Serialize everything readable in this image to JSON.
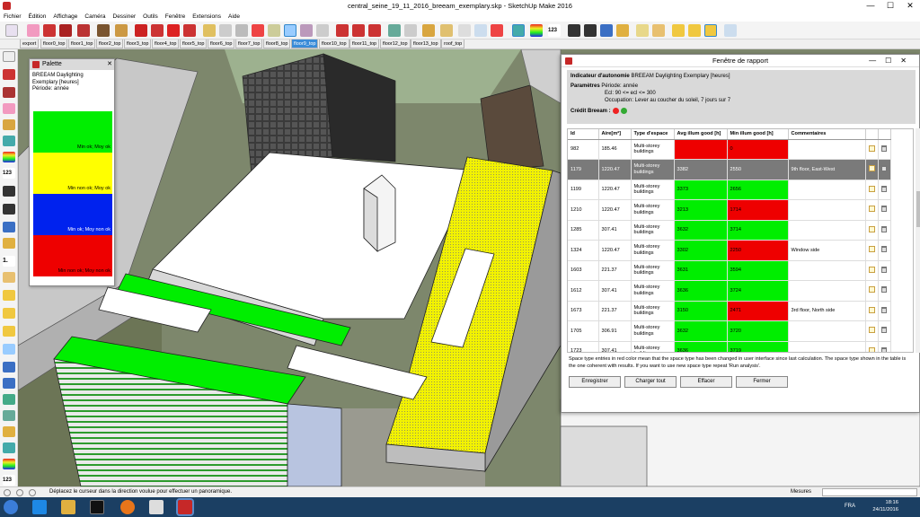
{
  "window": {
    "title": "central_seine_19_11_2016_breeam_exemplary.skp - SketchUp Make 2016",
    "minimize": "—",
    "maximize": "☐",
    "close": "✕"
  },
  "menu": [
    "Fichier",
    "Édition",
    "Affichage",
    "Caméra",
    "Dessiner",
    "Outils",
    "Fenêtre",
    "Extensions",
    "Aide"
  ],
  "scene_tabs": [
    "export",
    "floor0_top",
    "floor1_top",
    "floor2_top",
    "floor3_top",
    "floor4_top",
    "floor5_top",
    "floor6_top",
    "floor7_top",
    "floor8_top",
    "floor9_top",
    "floor10_top",
    "floor11_top",
    "floor12_top",
    "floor13_top",
    "roof_top"
  ],
  "active_scene": "floor9_top",
  "palette": {
    "title": "Palette",
    "close": "✕",
    "line1": "BREEAM Daylighting",
    "line2": "Exemplary [heures]",
    "line3": "Période: année",
    "swatches": [
      {
        "label": "Min ok; Moy ok",
        "color": "#00ee00"
      },
      {
        "label": "Min non ok; Moy ok",
        "color": "#ffff00"
      },
      {
        "label": "Min ok; Moy non ok",
        "color": "#0022ee"
      },
      {
        "label": "Min non ok; Moy non ok",
        "color": "#ee0000"
      }
    ]
  },
  "report": {
    "title": "Fenêtre de rapport",
    "indicator_label": "Indicateur d'autonomie",
    "indicator_value": "BREEAM Daylighting Exemplary [heures]",
    "params_label": "Paramètres",
    "param1": "Période: année",
    "param2": "Ecl: 90 <= ecl <= 300",
    "param3": "Occupation: Lever au coucher du soleil, 7 jours sur 7",
    "credit_label": "Crédit Breeam :",
    "headers": [
      "Id",
      "Aire[m²]",
      "Type d'espace",
      "Avg illum good [h]",
      "Min illum good [h]",
      "Commentaires"
    ],
    "rows": [
      {
        "id": "982",
        "area": "185.46",
        "type": "Multi-storey buildings",
        "avg": "",
        "min": "0",
        "comment": "",
        "avg_color": "red",
        "min_color": "red"
      },
      {
        "id": "1179",
        "area": "1220.47",
        "type": "Multi-storey buildings",
        "avg": "3382",
        "min": "2550",
        "comment": "9th floor, East-West",
        "avg_color": "green",
        "min_color": "red"
      },
      {
        "id": "1199",
        "area": "1220.47",
        "type": "Multi-storey buildings",
        "avg": "3373",
        "min": "2656",
        "comment": "",
        "avg_color": "green",
        "min_color": "green"
      },
      {
        "id": "1210",
        "area": "1220.47",
        "type": "Multi-storey buildings",
        "avg": "3213",
        "min": "1714",
        "comment": "",
        "avg_color": "green",
        "min_color": "red"
      },
      {
        "id": "1285",
        "area": "307.41",
        "type": "Multi-storey buildings",
        "avg": "3632",
        "min": "3714",
        "comment": "",
        "avg_color": "green",
        "min_color": "green"
      },
      {
        "id": "1324",
        "area": "1220.47",
        "type": "Multi-storey buildings",
        "avg": "3302",
        "min": "2250",
        "comment": "Window side",
        "avg_color": "green",
        "min_color": "red"
      },
      {
        "id": "1603",
        "area": "221.37",
        "type": "Multi-storey buildings",
        "avg": "3631",
        "min": "3594",
        "comment": "",
        "avg_color": "green",
        "min_color": "green"
      },
      {
        "id": "1612",
        "area": "307.41",
        "type": "Multi-storey buildings",
        "avg": "3636",
        "min": "3724",
        "comment": "",
        "avg_color": "green",
        "min_color": "green"
      },
      {
        "id": "1673",
        "area": "221.37",
        "type": "Multi-storey buildings",
        "avg": "3150",
        "min": "2471",
        "comment": "3rd floor, North side",
        "avg_color": "green",
        "min_color": "red"
      },
      {
        "id": "1705",
        "area": "306.91",
        "type": "Multi-storey buildings",
        "avg": "3632",
        "min": "3720",
        "comment": "",
        "avg_color": "green",
        "min_color": "green"
      },
      {
        "id": "1723",
        "area": "307.41",
        "type": "Multi-storey buildings",
        "avg": "3636",
        "min": "3719",
        "comment": "",
        "avg_color": "green",
        "min_color": "green"
      }
    ],
    "selected_row": "1179",
    "note": "Space type entries in red color mean that the space type has been changed in user interface since last calculation. The space type shown in the table is the one coherent with results. If you want to use new space type repeat 'Run analysis'.",
    "buttons": {
      "save": "Enregistrer",
      "charge": "Charger tout",
      "clear": "Effacer",
      "close": "Fermer"
    }
  },
  "status": {
    "message": "Déplacez le curseur dans la direction voulue pour effectuer un panoramique.",
    "measures_label": "Mesures"
  },
  "taskbar": {
    "lang": "FRA",
    "time": "18:16",
    "date": "24/11/2016"
  }
}
